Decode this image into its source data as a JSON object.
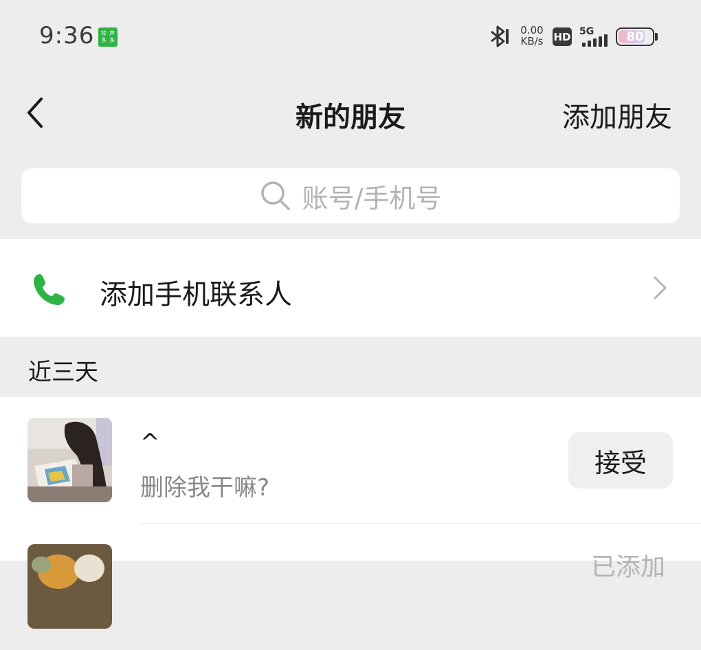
{
  "status_bar": {
    "time": "9:36",
    "app_badge_chars": [
      "铃",
      "声",
      "多",
      "多"
    ],
    "net_speed_value": "0.00",
    "net_speed_unit": "KB/s",
    "hd_label": "HD",
    "network_label": "5G",
    "battery_percent": "80",
    "battery_level": 0.8
  },
  "nav": {
    "title": "新的朋友",
    "add_friend_label": "添加朋友"
  },
  "search": {
    "placeholder": "账号/手机号"
  },
  "add_contacts": {
    "label": "添加手机联系人",
    "icon": "phone-icon",
    "icon_color": "#2fb344"
  },
  "section": {
    "title": "近三天"
  },
  "friends": [
    {
      "name": "^",
      "message": "删除我干嘛?",
      "action_label": "接受"
    },
    {
      "action_label": "已添加"
    }
  ]
}
